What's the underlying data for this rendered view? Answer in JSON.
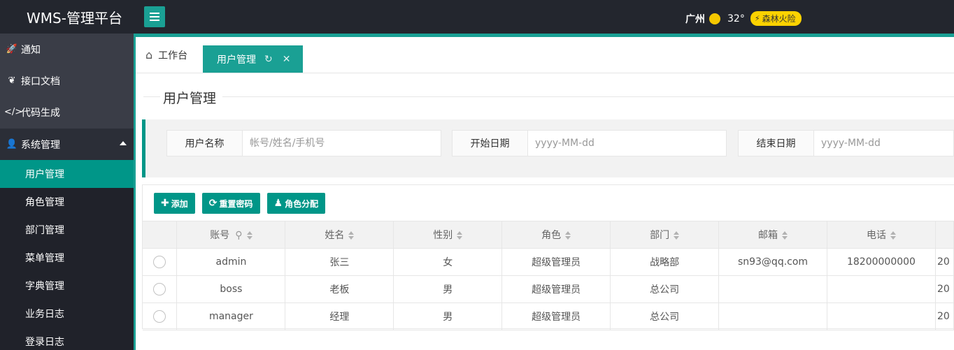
{
  "header": {
    "logo": "WMS-管理平台",
    "weather": {
      "city": "广州",
      "temp": "32°",
      "alert": "森林火险"
    }
  },
  "sidebar": {
    "top_items": [
      {
        "label": "通知",
        "icon": "rocket-icon"
      },
      {
        "label": "接口文档",
        "icon": "leaf-icon"
      },
      {
        "label": "代码生成",
        "icon": "code-icon"
      }
    ],
    "group": {
      "label": "系统管理",
      "icon": "user-icon"
    },
    "sub_items": [
      "用户管理",
      "角色管理",
      "部门管理",
      "菜单管理",
      "字典管理",
      "业务日志",
      "登录日志"
    ]
  },
  "tabs": {
    "home": "工作台",
    "active": "用户管理"
  },
  "page": {
    "title": "用户管理"
  },
  "search": {
    "fields": [
      {
        "label": "用户名称",
        "placeholder": "帐号/姓名/手机号"
      },
      {
        "label": "开始日期",
        "placeholder": "yyyy-MM-dd"
      },
      {
        "label": "结束日期",
        "placeholder": "yyyy-MM-dd"
      }
    ]
  },
  "toolbar": {
    "add": "添加",
    "reset": "重置密码",
    "assign": "角色分配"
  },
  "table": {
    "columns": [
      "账号",
      "姓名",
      "性别",
      "角色",
      "部门",
      "邮箱",
      "电话"
    ],
    "rows": [
      [
        "admin",
        "张三",
        "女",
        "超级管理员",
        "战略部",
        "sn93@qq.com",
        "18200000000",
        "20"
      ],
      [
        "boss",
        "老板",
        "男",
        "超级管理员",
        "总公司",
        "",
        "",
        "20"
      ],
      [
        "manager",
        "经理",
        "男",
        "超级管理员",
        "总公司",
        "",
        "",
        "20"
      ]
    ]
  },
  "colors": {
    "accent": "#009688",
    "header_bg": "#23262e",
    "sidebar_bg": "#2b2e37",
    "alert": "#fcd200"
  }
}
